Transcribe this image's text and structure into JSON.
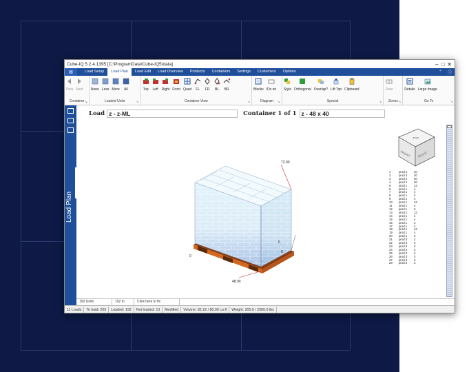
{
  "window": {
    "title": "Cube-IQ  5.2.4.1395  [C:\\ProgramData\\Cube-IQ5\\data]"
  },
  "menu": {
    "items": [
      "Load Setup",
      "Load Plan",
      "Load Edit",
      "Load Overview",
      "Products",
      "Containers",
      "Settings",
      "Customers",
      "Options"
    ],
    "active": "Load Plan"
  },
  "ribbon": {
    "groups": [
      {
        "label": "Container",
        "buttons": [
          "Prev",
          "Next"
        ]
      },
      {
        "label": "Loaded Units",
        "buttons": [
          "None",
          "Less",
          "More",
          "All"
        ]
      },
      {
        "label": "Container View",
        "buttons": [
          "Top",
          "Left",
          "Right",
          "Front",
          "Quad",
          "FL",
          "FR",
          "BL",
          "BR"
        ]
      },
      {
        "label": "Diagram",
        "buttons": [
          "Blocks",
          "IDs on"
        ]
      },
      {
        "label": "Special",
        "buttons": [
          "Style",
          "Orthogonal",
          "Overlap?",
          "Lift Top",
          "Clipboard"
        ]
      },
      {
        "label": "Zones",
        "buttons": [
          "Zone"
        ]
      },
      {
        "label": "Go To",
        "buttons": [
          "Details",
          "Large Image"
        ]
      }
    ]
  },
  "sidebar": {
    "label": "Load Plan"
  },
  "infobar": {
    "load_label": "Load",
    "load_value": "z - z-ML",
    "container_label": "Container 1 of 1",
    "container_value": "z - 48 x 40"
  },
  "scene": {
    "dim_top": "72.00",
    "dim_bottom": "48.00",
    "dim_right_a": "0",
    "dim_right_b": "0",
    "dim_left": "0",
    "cube_top": "TOP",
    "cube_front": "FRONT",
    "cube_right": "RIGHT",
    "colors": {
      "pallet": "#d4691e",
      "box_light": "#e3f3fb",
      "box_mid": "#c7dbf0",
      "box_dark": "#aac4e6"
    }
  },
  "legend": [
    [
      "1",
      "prod 2",
      "20"
    ],
    [
      "2",
      "prod 2",
      "20"
    ],
    [
      "3",
      "prod 2",
      "20"
    ],
    [
      "4",
      "prod 2",
      "20"
    ],
    [
      "5",
      "prod 1",
      "12"
    ],
    [
      "6",
      "prod 1",
      "4"
    ],
    [
      "7",
      "prod 1",
      "4"
    ],
    [
      "8",
      "prod 1",
      "3"
    ],
    [
      "9",
      "prod 1",
      "4"
    ],
    [
      "10",
      "prod 1",
      "12"
    ],
    [
      "11",
      "prod 1",
      "4"
    ],
    [
      "12",
      "prod 1",
      "3"
    ],
    [
      "13",
      "prod 1",
      "12"
    ],
    [
      "14",
      "prod 1",
      "4"
    ],
    [
      "15",
      "prod 1",
      "4"
    ],
    [
      "16",
      "prod 1",
      "3"
    ],
    [
      "17",
      "prod 1",
      "4"
    ],
    [
      "18",
      "prod 1",
      "12"
    ],
    [
      "19",
      "prod 1",
      "4"
    ],
    [
      "20",
      "prod 1",
      "3"
    ],
    [
      "21",
      "prod 3",
      "2"
    ],
    [
      "22",
      "prod 3",
      "3"
    ],
    [
      "23",
      "prod 3",
      "3"
    ],
    [
      "24",
      "prod 3",
      "3"
    ],
    [
      "25",
      "prod 3",
      "2"
    ],
    [
      "26",
      "prod 3",
      "3"
    ],
    [
      "27",
      "prod 3",
      "3"
    ],
    [
      "28",
      "prod 3",
      "2"
    ]
  ],
  "status2": [
    "192 Units",
    "192 in",
    "Click here to fix"
  ],
  "status": [
    "11 Loads",
    "To load: 205",
    "Loaded: 192",
    "Not loaded: 13",
    "Modified",
    "Volume: 82.22 / 80.00 cu.ft",
    "Weight: 205.0 / 2500.0 lbs"
  ]
}
